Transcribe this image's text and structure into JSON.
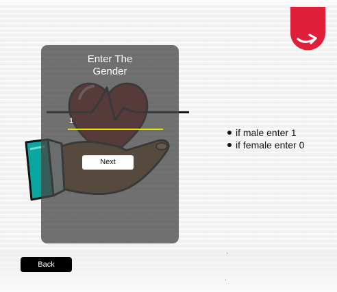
{
  "form": {
    "title": "Enter The Gender",
    "input_value": "1",
    "next_label": "Next"
  },
  "instructions": [
    "if male enter 1",
    "if female enter 0"
  ],
  "navigation": {
    "back_label": "Back"
  },
  "icons": {
    "brand": "share-arrow-icon",
    "illustration": "heart-in-hand-icon"
  },
  "colors": {
    "brand_red": "#e0203a",
    "input_underline": "#e6e000",
    "card_overlay": "#464646",
    "heart": "#8e1616",
    "sleeve": "#0aa6a0",
    "hand": "#8b5a2b"
  }
}
